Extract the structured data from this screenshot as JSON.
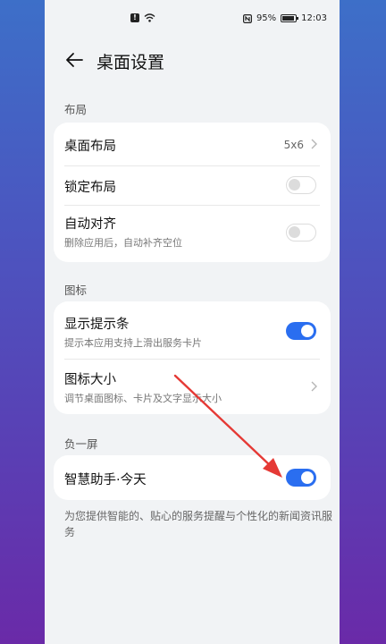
{
  "status_bar": {
    "battery": "95%",
    "time": "12:03",
    "icons": [
      "alert-icon",
      "wifi-icon",
      "nfc-icon",
      "battery-icon"
    ]
  },
  "header": {
    "title": "桌面设置",
    "back_icon": "back-arrow-icon"
  },
  "sections": {
    "layout": {
      "label": "布局",
      "items": {
        "desktop_layout": {
          "title": "桌面布局",
          "value": "5x6"
        },
        "lock_layout": {
          "title": "锁定布局",
          "toggle": false
        },
        "auto_align": {
          "title": "自动对齐",
          "subtitle": "删除应用后，自动补齐空位",
          "toggle": false
        }
      }
    },
    "icons": {
      "label": "图标",
      "items": {
        "show_hint_bar": {
          "title": "显示提示条",
          "subtitle": "提示本应用支持上滑出服务卡片",
          "toggle": true
        },
        "icon_size": {
          "title": "图标大小",
          "subtitle": "调节桌面图标、卡片及文字显示大小"
        }
      }
    },
    "minus_one": {
      "label": "负一屏",
      "items": {
        "smart_assistant": {
          "title": "智慧助手·今天",
          "toggle": true
        }
      },
      "footnote": "为您提供智能的、贴心的服务提醒与个性化的新闻资讯服务"
    }
  },
  "colors": {
    "accent": "#2a6ef0",
    "annotation_arrow": "#e53935"
  }
}
